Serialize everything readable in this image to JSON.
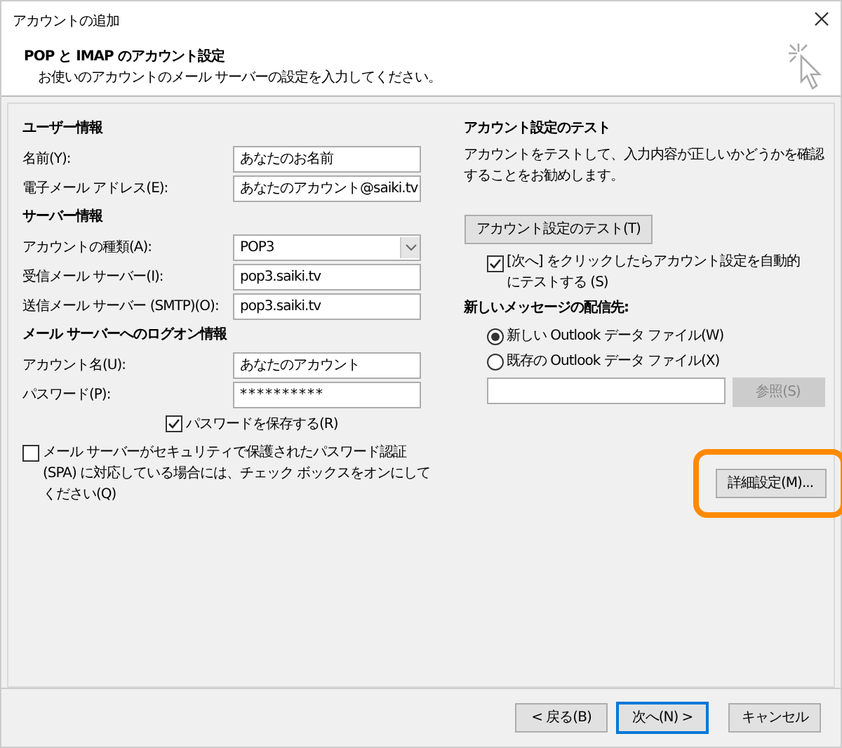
{
  "window": {
    "title": "アカウントの追加"
  },
  "header": {
    "title": "POP と IMAP のアカウント設定",
    "subtitle": "お使いのアカウントのメール サーバーの設定を入力してください。"
  },
  "sections": [
    {
      "heading": "ユーザー情報",
      "fields": [
        {
          "kind": "text",
          "label": "名前(Y):",
          "value": "あなたのお名前"
        },
        {
          "kind": "text",
          "label": "電子メール アドレス(E):",
          "value": "あなたのアカウント@saiki.tv"
        }
      ]
    },
    {
      "heading": "サーバー情報",
      "fields": [
        {
          "kind": "select",
          "label": "アカウントの種類(A):",
          "value": "POP3"
        },
        {
          "kind": "text",
          "label": "受信メール サーバー(I):",
          "value": "pop3.saiki.tv"
        },
        {
          "kind": "text",
          "label": "送信メール サーバー (SMTP)(O):",
          "value": "pop3.saiki.tv"
        }
      ]
    },
    {
      "heading": "メール サーバーへのログオン情報",
      "fields": [
        {
          "kind": "text",
          "label": "アカウント名(U):",
          "value": "あなたのアカウント"
        },
        {
          "kind": "password",
          "label": "パスワード(P):",
          "value": "**********"
        }
      ]
    }
  ],
  "save_password": {
    "label": "パスワードを保存する(R)",
    "checked": true
  },
  "spa": {
    "label": "メール サーバーがセキュリティで保護されたパスワード認証 (SPA) に対応している場合には、チェック ボックスをオンにしてください(Q)",
    "checked": false
  },
  "test": {
    "heading": "アカウント設定のテスト",
    "description": "アカウントをテストして、入力内容が正しいかどうかを確認することをお勧めします。",
    "button": "アカウント設定のテスト(T)",
    "auto_test": {
      "label": "[次へ] をクリックしたらアカウント設定を自動的にテストする (S)",
      "checked": true
    }
  },
  "delivery": {
    "heading": "新しいメッセージの配信先:",
    "options": [
      {
        "label": "新しい Outlook データ ファイル(W)",
        "selected": true
      },
      {
        "label": "既存の Outlook データ ファイル(X)",
        "selected": false
      }
    ],
    "browse": {
      "label": "参照(S)",
      "disabled": true
    }
  },
  "advanced": {
    "label": "詳細設定(M)...",
    "highlighted": true
  },
  "footer_buttons": [
    {
      "label": "< 戻る(B)",
      "default": false
    },
    {
      "label": "次へ(N) >",
      "default": true
    },
    {
      "label": "キャンセル",
      "default": false
    }
  ]
}
